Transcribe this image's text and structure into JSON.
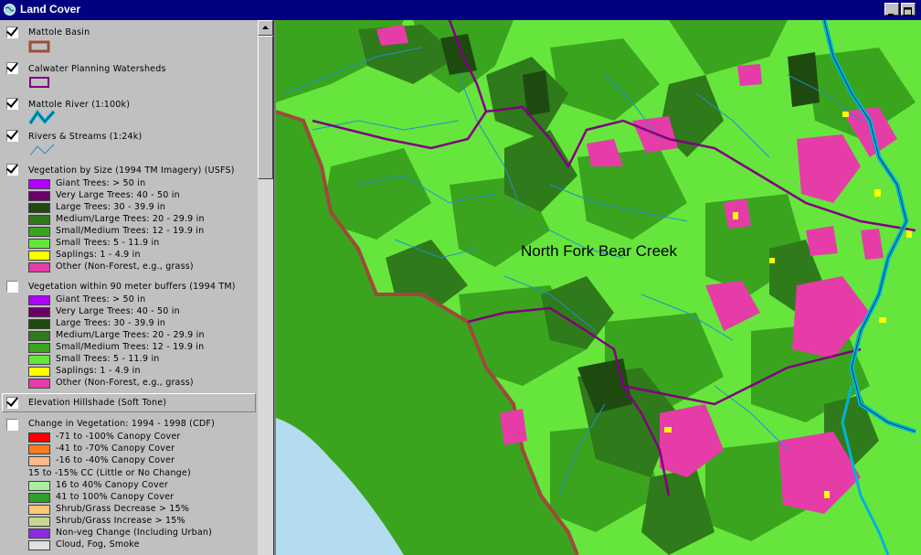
{
  "window": {
    "title": "Land Cover",
    "minimize_label": "",
    "maximize_label": ""
  },
  "toc": {
    "themes": [
      {
        "id": "mattole-basin",
        "name": "Mattole Basin",
        "checked": true,
        "symbol": "polygon-outline",
        "outline_color": "#9e4a3c"
      },
      {
        "id": "calwater",
        "name": "Calwater Planning Watersheds",
        "checked": true,
        "symbol": "polygon-outline",
        "outline_color": "#800080"
      },
      {
        "id": "mattole-river",
        "name": "Mattole River (1:100k)",
        "checked": true,
        "symbol": "line",
        "line_color": "#00b4d8"
      },
      {
        "id": "rivers-streams",
        "name": "Rivers & Streams (1:24k)",
        "checked": true,
        "symbol": "line",
        "line_color": "#1f8fd0"
      },
      {
        "id": "veg-size",
        "name": "Vegetation by Size (1994 TM Imagery) (USFS)",
        "checked": true,
        "classes": [
          {
            "label": "Giant Trees: > 50 in",
            "color": "#b000ff"
          },
          {
            "label": "Very Large Trees: 40 - 50 in",
            "color": "#6a006a"
          },
          {
            "label": "Large Trees: 30 - 39.9 in",
            "color": "#1e4a10"
          },
          {
            "label": "Medium/Large Trees: 20 - 29.9 in",
            "color": "#2f7a1a"
          },
          {
            "label": "Small/Medium Trees: 12 - 19.9 in",
            "color": "#3aa41e"
          },
          {
            "label": "Small Trees: 5 - 11.9 in",
            "color": "#66e63c"
          },
          {
            "label": "Saplings: 1 - 4.9 in",
            "color": "#ffff00"
          },
          {
            "label": "Other (Non-Forest, e.g., grass)",
            "color": "#e63ca8"
          }
        ]
      },
      {
        "id": "veg-buffers",
        "name": "Vegetation within 90 meter buffers (1994 TM)",
        "checked": false,
        "classes": [
          {
            "label": "Giant Trees: > 50 in",
            "color": "#b000ff"
          },
          {
            "label": "Very Large Trees: 40 - 50 in",
            "color": "#6a006a"
          },
          {
            "label": "Large Trees: 30 - 39.9 in",
            "color": "#1e4a10"
          },
          {
            "label": "Medium/Large Trees: 20 - 29.9 in",
            "color": "#2f7a1a"
          },
          {
            "label": "Small/Medium Trees: 12 - 19.9 in",
            "color": "#3aa41e"
          },
          {
            "label": "Small Trees: 5 - 11.9 in",
            "color": "#66e63c"
          },
          {
            "label": "Saplings: 1 - 4.9 in",
            "color": "#ffff00"
          },
          {
            "label": "Other (Non-Forest, e.g., grass)",
            "color": "#e63ca8"
          }
        ]
      },
      {
        "id": "hillshade",
        "name": "Elevation Hillshade (Soft Tone)",
        "checked": true
      },
      {
        "id": "veg-change",
        "name": "Change in Vegetation: 1994 - 1998 (CDF)",
        "checked": false,
        "classes": [
          {
            "label": "-71 to -100% Canopy Cover",
            "color": "#ff0000"
          },
          {
            "label": "-41 to -70% Canopy Cover",
            "color": "#ff7a1e"
          },
          {
            "label": "-16 to -40% Canopy Cover",
            "color": "#ffb88a"
          },
          {
            "label": "15 to -15% CC (Little or No Change)",
            "color": null
          },
          {
            "label": "16 to 40% Canopy Cover",
            "color": "#a8f0a0"
          },
          {
            "label": "41 to 100% Canopy Cover",
            "color": "#2fa02a"
          },
          {
            "label": "Shrub/Grass Decrease > 15%",
            "color": "#ffc878"
          },
          {
            "label": "Shrub/Grass Increase > 15%",
            "color": "#c8d890"
          },
          {
            "label": "Non-veg Change (Including Urban)",
            "color": "#8a2be2"
          },
          {
            "label": "Cloud, Fog, Smoke",
            "color": "#e0e0e0"
          }
        ]
      }
    ]
  },
  "map": {
    "feature_label": "North Fork Bear Creek",
    "colors": {
      "ocean": "#b4dcf0",
      "light_green": "#66e63c",
      "medium_green": "#3aa41e",
      "dark_green": "#2f7a1a",
      "large_trees": "#1e4a10",
      "other": "#e63ca8",
      "saplings": "#ffff00",
      "basin_outline": "#9e4a3c",
      "watershed": "#800080",
      "river": "#00b4d8",
      "streams": "#1f8fd0"
    }
  }
}
